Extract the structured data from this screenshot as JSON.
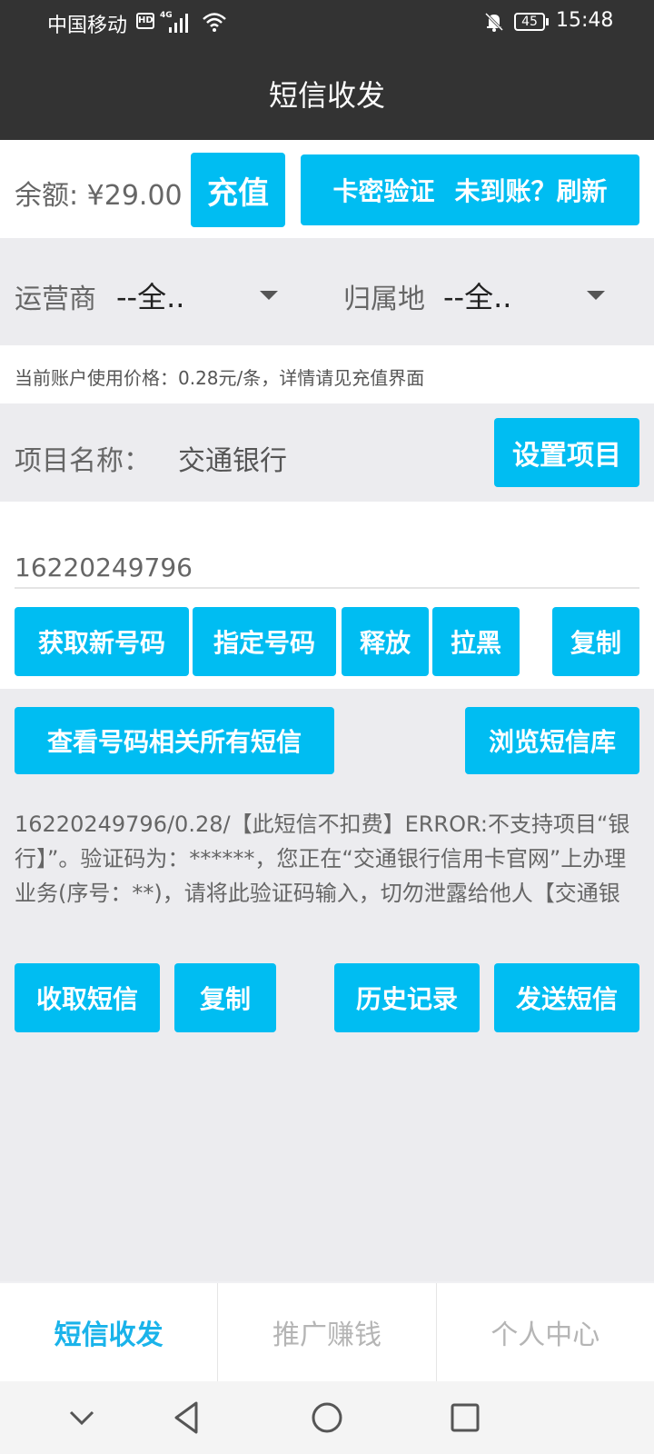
{
  "status_bar": {
    "carrier": "中国移动",
    "hd": "HD",
    "network": "4G",
    "battery": "45",
    "time": "15:48"
  },
  "header": {
    "title": "短信收发"
  },
  "balance": {
    "label": "余额: ¥29.00",
    "recharge_button": "充值",
    "card_verify": "卡密验证",
    "not_arrived_refresh": "未到账？刷新"
  },
  "filters": {
    "carrier_label": "运营商",
    "carrier_value": "--全..",
    "location_label": "归属地",
    "location_value": "--全.."
  },
  "price_note": "当前账户使用价格：0.28元/条，详情请见充值界面",
  "project": {
    "label": "项目名称：",
    "name": "交通银行",
    "set_button": "设置项目"
  },
  "number": {
    "value": "16220249796",
    "buttons": {
      "get_new": "获取新号码",
      "specify": "指定号码",
      "release": "释放",
      "blacklist": "拉黑",
      "copy": "复制"
    }
  },
  "sms": {
    "view_all_button": "查看号码相关所有短信",
    "browse_button": "浏览短信库",
    "content": "16220249796/0.28/【此短信不扣费】ERROR:不支持项目“银行】”。验证码为：******，您正在“交通银行信用卡官网”上办理业务(序号：**)，请将此验证码输入，切勿泄露给他人【交通银行】【交通银行】",
    "buttons": {
      "receive": "收取短信",
      "copy": "复制",
      "history": "历史记录",
      "send": "发送短信"
    }
  },
  "bottom_nav": {
    "items": [
      {
        "label": "短信收发",
        "active": true
      },
      {
        "label": "推广赚钱",
        "active": false
      },
      {
        "label": "个人中心",
        "active": false
      }
    ]
  },
  "colors": {
    "accent": "#00bdf2",
    "header": "#333333",
    "active_tab": "#1ab3ea"
  }
}
